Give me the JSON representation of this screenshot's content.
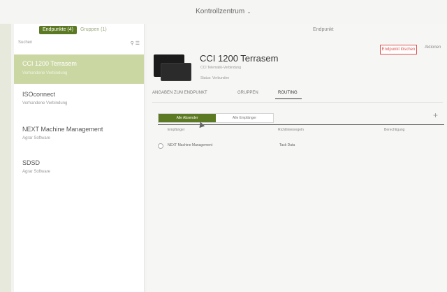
{
  "window": {
    "title": "Kontrollzentrum"
  },
  "sidebar": {
    "segments": [
      {
        "label": "Endpunkte (4)"
      },
      {
        "label": "Gruppen (1)"
      }
    ],
    "search": {
      "placeholder": "Suchen"
    },
    "items": [
      {
        "name": "CCI 1200 Terrasem",
        "subtitle": "Vorhandene Verbindung"
      },
      {
        "name": "ISOconnect",
        "subtitle": "Vorhandene Verbindung"
      },
      {
        "name": "NEXT Machine Management",
        "subtitle": "Agrar Software"
      },
      {
        "name": "SDSD",
        "subtitle": "Agrar Software"
      }
    ]
  },
  "header": {
    "endpunkt_tab": "Endpunkt",
    "delete_button": "Endpunkt löschen",
    "more_button": "Aktionen"
  },
  "device": {
    "name": "CCI 1200 Terrasem",
    "line1": "CCI Telematik-Verbindung",
    "line2": "Status: Verbunden"
  },
  "tabs": [
    {
      "label": "ANGABEN ZUM ENDPUNKT"
    },
    {
      "label": "GRUPPEN"
    },
    {
      "label": "ROUTING"
    }
  ],
  "routing": {
    "segments": [
      {
        "label": "Alle Absender"
      },
      {
        "label": "Alle Empfänger"
      }
    ],
    "columns": [
      "Empfänger",
      "Richtlinienregeln",
      "Berechtigung"
    ],
    "rows": [
      {
        "receiver": "NEXT Machine Management",
        "rule": "Task Data"
      }
    ]
  }
}
